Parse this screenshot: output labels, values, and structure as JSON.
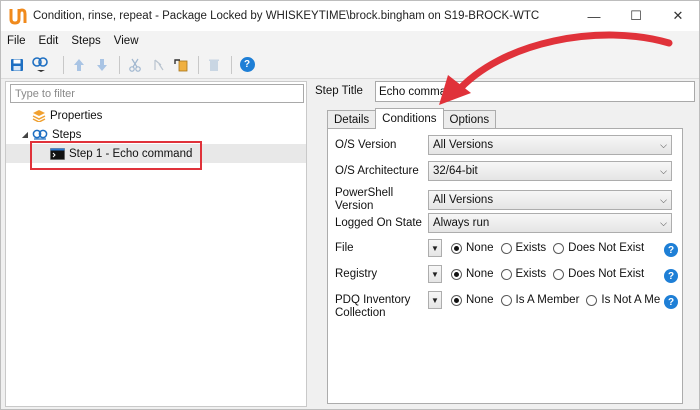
{
  "window": {
    "title": "Condition, rinse, repeat - Package Locked by WHISKEYTIME\\brock.bingham on S19-BROCK-WTC",
    "controls": {
      "minimize": "—",
      "maximize": "☐",
      "close": "✕"
    }
  },
  "menu": {
    "items": [
      "File",
      "Edit",
      "Steps",
      "View"
    ]
  },
  "toolbar": {
    "icons": [
      "save-icon",
      "add-step-icon",
      "move-up-icon",
      "move-down-icon",
      "cut-icon",
      "copy-icon",
      "paste-icon",
      "delete-icon",
      "help-icon"
    ]
  },
  "filter": {
    "placeholder": "Type to filter",
    "value": ""
  },
  "tree": {
    "properties": "Properties",
    "steps": "Steps",
    "step1": "Step 1 - Echo command"
  },
  "step": {
    "title_label": "Step Title",
    "title_value": "Echo command"
  },
  "tabs": [
    "Details",
    "Conditions",
    "Options"
  ],
  "active_tab": "Conditions",
  "conditions": {
    "os_version": {
      "label": "O/S Version",
      "value": "All Versions"
    },
    "os_arch": {
      "label": "O/S Architecture",
      "value": "32/64-bit"
    },
    "ps_version": {
      "label": "PowerShell Version",
      "value": "All Versions"
    },
    "logged_on": {
      "label": "Logged On State",
      "value": "Always run"
    },
    "file": {
      "label": "File",
      "options": [
        "None",
        "Exists",
        "Does Not Exist"
      ],
      "selected": "None"
    },
    "registry": {
      "label": "Registry",
      "options": [
        "None",
        "Exists",
        "Does Not Exist"
      ],
      "selected": "None"
    },
    "pdq": {
      "label": "PDQ Inventory Collection",
      "options": [
        "None",
        "Is A Member",
        "Is Not A Me"
      ],
      "selected": "None"
    }
  },
  "glyphs": {
    "help": "?",
    "dropdown": "▼",
    "chevron": "⌵",
    "collapse": "◢"
  },
  "colors": {
    "annotation": "#e0323a",
    "help": "#1e7fd6",
    "brand": "#f08a1c"
  }
}
